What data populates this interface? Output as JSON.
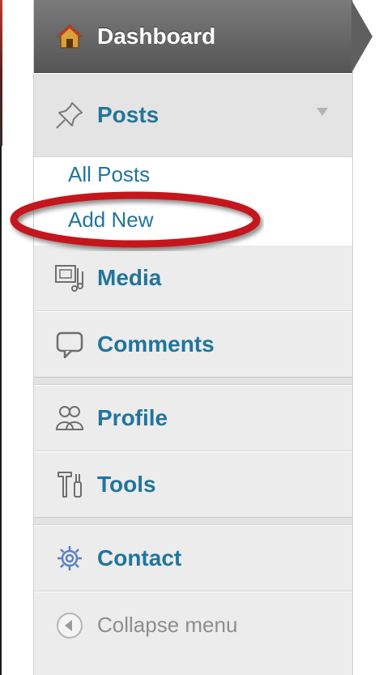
{
  "menu": {
    "dashboard": {
      "label": "Dashboard",
      "icon": "home-icon"
    },
    "posts": {
      "label": "Posts",
      "icon": "pushpin-icon",
      "submenu": [
        {
          "label": "All Posts"
        },
        {
          "label": "Add New"
        }
      ]
    },
    "media": {
      "label": "Media",
      "icon": "media-icon"
    },
    "comments": {
      "label": "Comments",
      "icon": "comment-bubble-icon"
    },
    "profile": {
      "label": "Profile",
      "icon": "users-icon"
    },
    "tools": {
      "label": "Tools",
      "icon": "tools-icon"
    },
    "contact": {
      "label": "Contact",
      "icon": "gear-icon"
    },
    "collapse": {
      "label": "Collapse menu",
      "icon": "collapse-arrow-icon"
    }
  },
  "colors": {
    "link": "#21759b",
    "active_bg": "#6b6b6b",
    "annotation_ring": "#c4151c"
  }
}
